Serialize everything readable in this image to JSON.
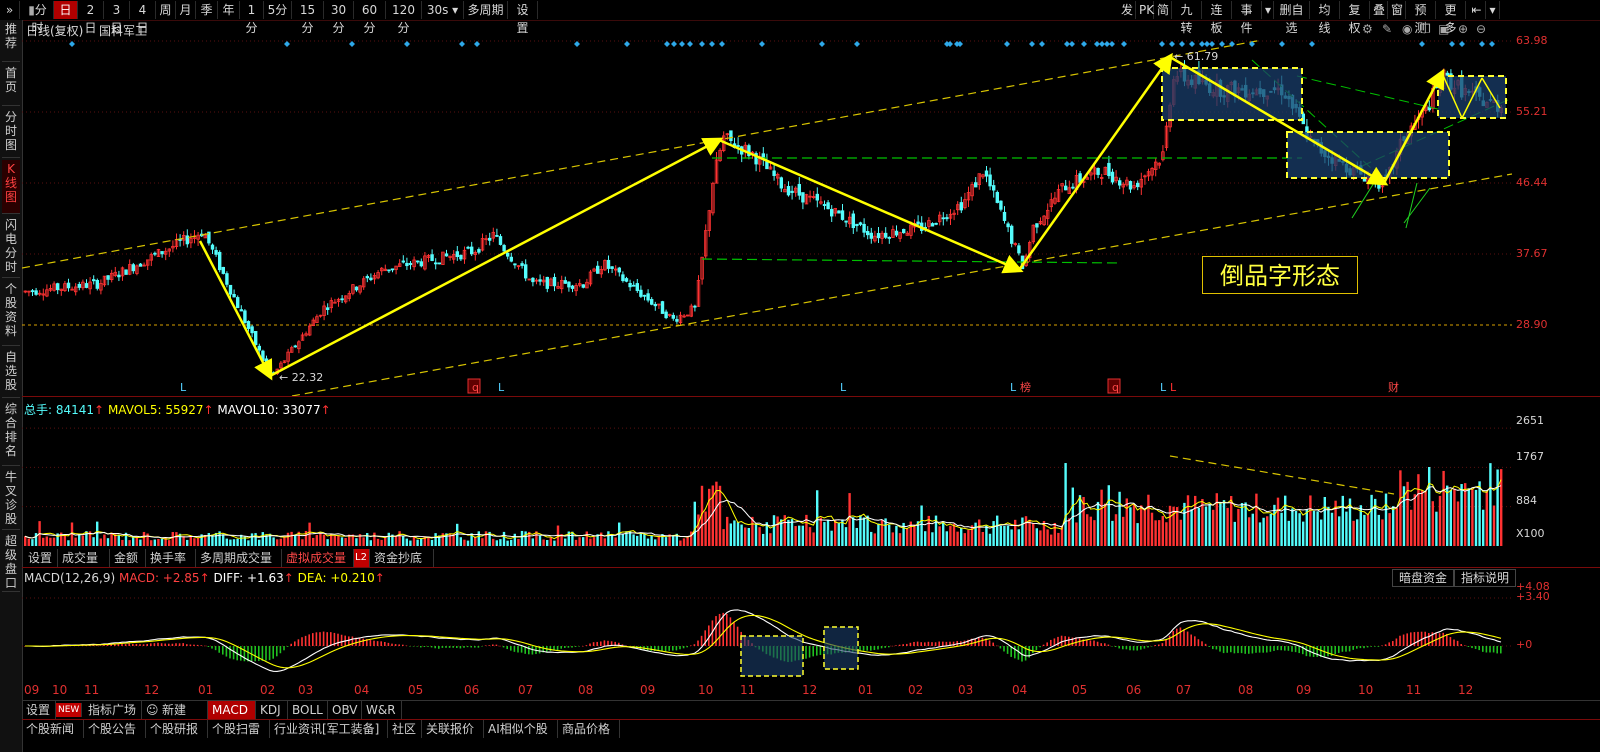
{
  "topbar": {
    "left_items": [
      "分时",
      "日",
      "2日",
      "3日",
      "4日",
      "周",
      "月",
      "季",
      "年",
      "1分",
      "5分",
      "15分",
      "30分",
      "60分",
      "120分",
      "30s",
      "多周期",
      "设置"
    ],
    "active_item": "日",
    "right_items": [
      "发",
      "PK",
      "简",
      "九转",
      "连板",
      "事件",
      "删自选",
      "均线",
      "复权",
      "叠",
      "窗",
      "预测",
      "更多"
    ]
  },
  "sidebar": {
    "items": [
      "推荐",
      "首页",
      "分时图",
      "K线图",
      "闪电分时",
      "个股资料",
      "自选股",
      "综合排名",
      "牛叉诊股",
      "超级盘口"
    ],
    "active": "K线图"
  },
  "main": {
    "header_left": "日线(复权)",
    "stock_name": "国科军工",
    "price_levels": [
      "63.98",
      "55.21",
      "46.44",
      "37.67",
      "28.90"
    ],
    "annotation_text": "倒品字形态",
    "low_label": "22.32",
    "high_label": "61.79",
    "event_markers": [
      "L",
      "q",
      "L",
      "L",
      "L",
      "榜",
      "q",
      "L",
      "L",
      "财"
    ]
  },
  "volume": {
    "header": {
      "total_label": "总手: 84141",
      "mavol5_label": "MAVOL5: 55927",
      "mavol10_label": "MAVOL10: 33077"
    },
    "scale_labels": [
      "2651",
      "1767",
      "884",
      "X100"
    ]
  },
  "vol_tabs": [
    "设置",
    "成交量",
    "金额",
    "换手率",
    "多周期成交量",
    "虚拟成交量",
    "资金抄底"
  ],
  "vol_tab_active": "虚拟成交量",
  "l2_badge": "L2",
  "macd": {
    "header": {
      "title": "MACD(12,26,9)",
      "macd_val": "MACD: +2.85",
      "diff_val": "DIFF: +1.63",
      "dea_val": "DEA: +0.210"
    },
    "buttons": [
      "暗盘资金",
      "指标说明"
    ],
    "scale_labels": [
      "+4.08",
      "+3.40",
      "+0"
    ]
  },
  "x_axis": {
    "months": [
      "09",
      "10",
      "11",
      "12",
      "01",
      "02",
      "03",
      "04",
      "05",
      "06",
      "07",
      "08",
      "09",
      "10",
      "11",
      "12",
      "01",
      "02",
      "03",
      "04",
      "05",
      "06",
      "07",
      "08",
      "09",
      "10",
      "11",
      "12"
    ]
  },
  "indicator_tabs": {
    "items": [
      "设置",
      "指标广场",
      "新建",
      "MACD",
      "KDJ",
      "BOLL",
      "OBV",
      "W&R"
    ],
    "active": "MACD",
    "new_badge": "NEW"
  },
  "bottom_links": [
    "个股新闻",
    "个股公告",
    "个股研报",
    "个股扫雷",
    "行业资讯[军工装备]",
    "社区",
    "关联报价",
    "AI相似个股",
    "商品价格"
  ],
  "colors": {
    "up": "#ff3232",
    "down": "#54fcfc",
    "trend_arrow": "#ffff00",
    "channel": "#d8c400",
    "hline_green": "#00c000",
    "box_fill": "#1a3d6b",
    "ma_white": "#ffffff",
    "ma_yellow": "#ffff00"
  },
  "chart_data": {
    "type": "candlestick",
    "price_axis": [
      28.9,
      37.67,
      46.44,
      55.21,
      63.98
    ],
    "trend_path": [
      {
        "label": "peak",
        "price": 40.5
      },
      {
        "label": "low",
        "price": 22.32
      },
      {
        "label": "peak",
        "price": 52.0
      },
      {
        "label": "low",
        "price": 35.8
      },
      {
        "label": "high",
        "price": 61.79
      },
      {
        "label": "low",
        "price": 46.2
      },
      {
        "label": "peak",
        "price": 59.5
      }
    ],
    "volume_axis": [
      884,
      1767,
      2651
    ],
    "macd_axis": [
      0,
      3.4,
      4.08
    ]
  }
}
